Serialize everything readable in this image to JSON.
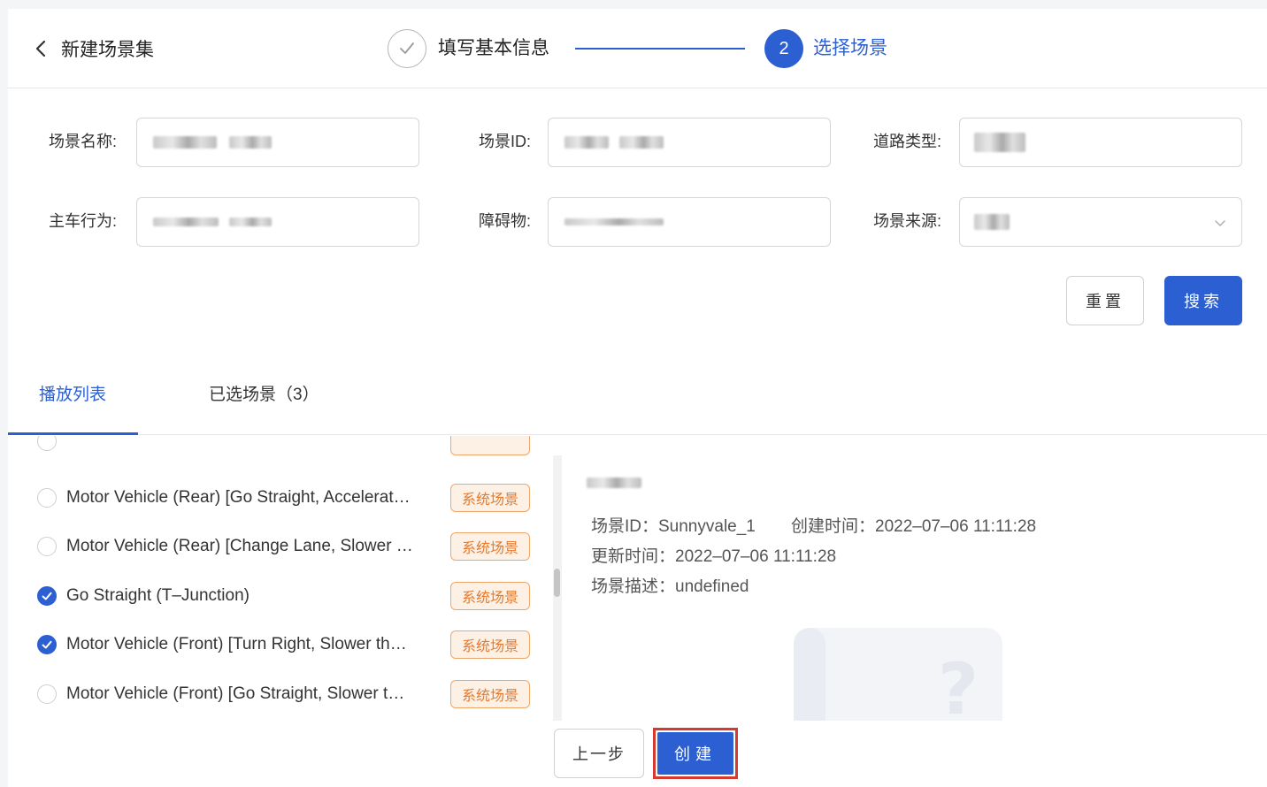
{
  "header": {
    "title": "新建场景集",
    "steps": [
      {
        "label": "填写基本信息",
        "status": "done"
      },
      {
        "number": "2",
        "label": "选择场景",
        "status": "active"
      }
    ]
  },
  "form": {
    "scene_name_label": "场景名称:",
    "scene_id_label": "场景ID:",
    "road_type_label": "道路类型:",
    "ego_behavior_label": "主车行为:",
    "obstacle_label": "障碍物:",
    "source_label": "场景来源:",
    "reset_label": "重置",
    "search_label": "搜索"
  },
  "tabs": [
    {
      "label": "播放列表",
      "active": true
    },
    {
      "label": "已选场景（3）",
      "active": false
    }
  ],
  "list": {
    "items": [
      {
        "text": "Motor Vehicle (Rear) [Go Straight, Accelerat…",
        "tag": "系统场景",
        "checked": false
      },
      {
        "text": "Motor Vehicle (Rear) [Change Lane, Slower …",
        "tag": "系统场景",
        "checked": false
      },
      {
        "text": "Go Straight (T–Junction)",
        "tag": "系统场景",
        "checked": true
      },
      {
        "text": "Motor Vehicle (Front) [Turn Right, Slower th…",
        "tag": "系统场景",
        "checked": true
      },
      {
        "text": "Motor Vehicle (Front) [Go Straight, Slower t…",
        "tag": "系统场景",
        "checked": false
      }
    ]
  },
  "detail": {
    "scene_id_line": "场景ID：Sunnyvale_1",
    "created_line": "创建时间：2022–07–06 11:11:28",
    "updated_line": "更新时间：2022–07–06 11:11:28",
    "desc_line": "场景描述：undefined"
  },
  "footer": {
    "prev_label": "上一步",
    "create_label": "创建"
  },
  "colors": {
    "primary": "#2c5fd2",
    "tag_text": "#e5792d",
    "tag_bg": "#fdf1e6",
    "highlight": "#d43a2f"
  }
}
